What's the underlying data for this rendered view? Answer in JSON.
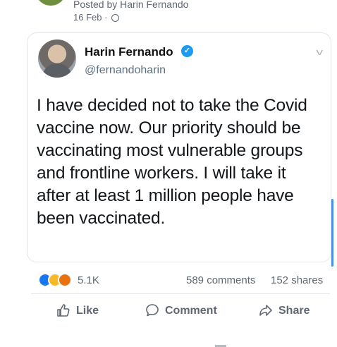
{
  "post": {
    "posted_by": "Posted by Harin Fernando",
    "date": "16 Feb",
    "separator": "·",
    "privacy_icon": "globe-icon"
  },
  "tweet": {
    "author_name": "Harin Fernando",
    "verified_icon": "verified-badge-icon",
    "verified_color": "#1d9bf0",
    "handle": "@fernandoharin",
    "text": "I have decided not to take the Covid vaccine now. Our priority should be vaccinating most vulnerable groups and frontline workers. I will take it after at least 1 million people have been vaccinated."
  },
  "stats": {
    "reaction_icons": [
      "like-reaction-icon",
      "haha-reaction-icon",
      "angry-reaction-icon"
    ],
    "reactions_count": "5.1K",
    "comments": "589 comments",
    "shares": "152 shares"
  },
  "actions": {
    "like": "Like",
    "comment": "Comment",
    "share": "Share"
  }
}
